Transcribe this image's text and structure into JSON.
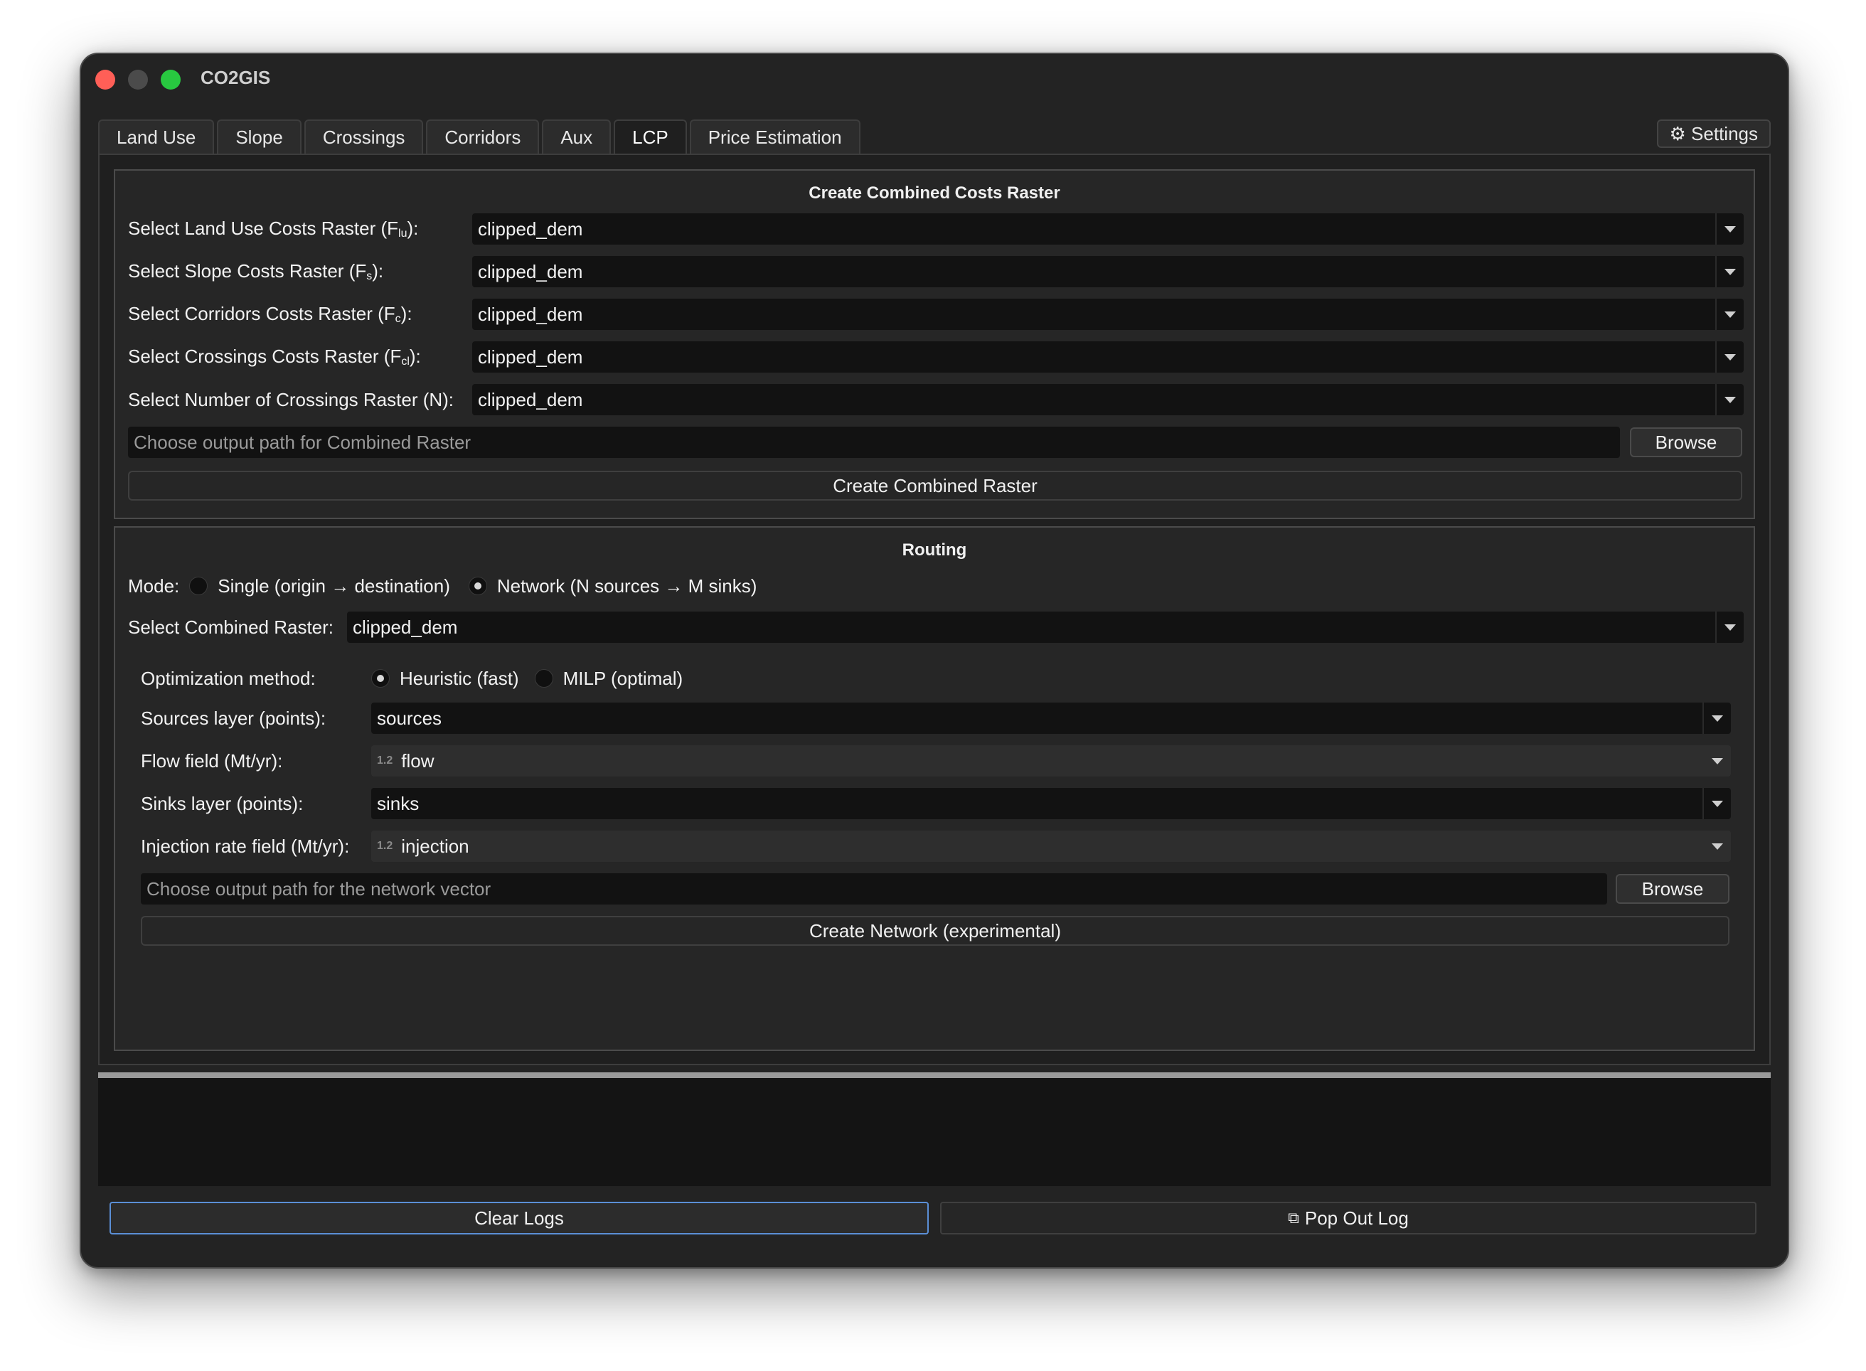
{
  "window": {
    "title": "CO2GIS"
  },
  "tabs": [
    "Land Use",
    "Slope",
    "Crossings",
    "Corridors",
    "Aux",
    "LCP",
    "Price Estimation"
  ],
  "active_tab": "LCP",
  "settings_label": "⚙ Settings",
  "combined": {
    "title": "Create Combined Costs Raster",
    "rows": [
      {
        "label": "Select Land Use Costs Raster (F",
        "sub": "lu",
        "suffix": "):",
        "value": "clipped_dem"
      },
      {
        "label": "Select Slope Costs Raster (F",
        "sub": "s",
        "suffix": "):",
        "value": "clipped_dem"
      },
      {
        "label": "Select Corridors Costs Raster (F",
        "sub": "c",
        "suffix": "):",
        "value": "clipped_dem"
      },
      {
        "label": "Select Crossings Costs Raster (F",
        "sub": "cl",
        "suffix": "):",
        "value": "clipped_dem"
      },
      {
        "label": "Select Number of Crossings Raster (N):",
        "sub": "",
        "suffix": "",
        "value": "clipped_dem"
      }
    ],
    "output_placeholder": "Choose output path for Combined Raster",
    "browse_label": "Browse",
    "create_label": "Create Combined Raster"
  },
  "routing": {
    "title": "Routing",
    "mode_label": "Mode:",
    "mode_single": "Single (origin → destination)",
    "mode_network": "Network (N sources → M sinks)",
    "selected_mode": "network",
    "raster_label": "Select Combined Raster:",
    "raster_value": "clipped_dem",
    "opt_label": "Optimization method:",
    "opt_heuristic": "Heuristic (fast)",
    "opt_milp": "MILP (optimal)",
    "selected_opt": "heuristic",
    "sources_label": "Sources layer (points):",
    "sources_value": "sources",
    "flow_label": "Flow field (Mt/yr):",
    "flow_badge": "1.2",
    "flow_value": "flow",
    "sinks_label": "Sinks layer (points):",
    "sinks_value": "sinks",
    "injection_label": "Injection rate field (Mt/yr):",
    "injection_badge": "1.2",
    "injection_value": "injection",
    "output_placeholder": "Choose output path for the network vector",
    "browse_label": "Browse",
    "create_label": "Create Network (experimental)"
  },
  "footer": {
    "clear_label": "Clear Logs",
    "pop_label": "Pop Out Log",
    "pop_icon": "⧉"
  },
  "colors": {
    "focus_border": "#5b8fd6",
    "window_bg": "#232323"
  }
}
